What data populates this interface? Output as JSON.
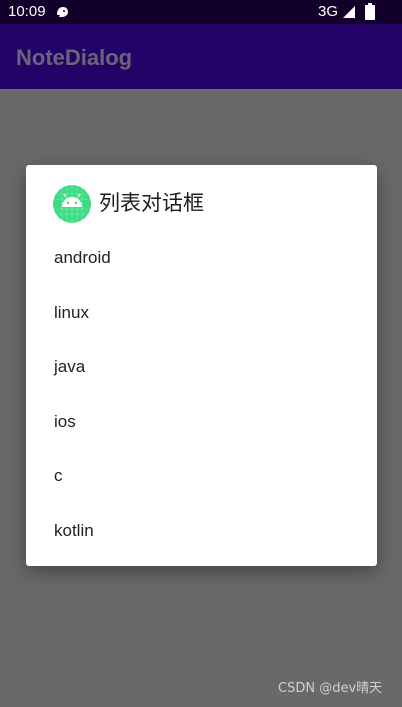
{
  "status_bar": {
    "time": "10:09",
    "network": "3G",
    "notification_icon": "cat-notification-icon",
    "signal_icon": "signal-icon",
    "battery_icon": "battery-icon"
  },
  "app_bar": {
    "title": "NoteDialog"
  },
  "dialog": {
    "icon": "android-robot-icon",
    "title": "列表对话框",
    "items": [
      {
        "label": "android"
      },
      {
        "label": "linux"
      },
      {
        "label": "java"
      },
      {
        "label": "ios"
      },
      {
        "label": "c"
      },
      {
        "label": "kotlin"
      }
    ]
  },
  "watermark": "CSDN @dev晴天",
  "colors": {
    "status_bar": "#12002a",
    "app_bar": "#240369",
    "scrim": "#696969",
    "dialog_bg": "#ffffff",
    "android_green": "#3ddc84"
  }
}
